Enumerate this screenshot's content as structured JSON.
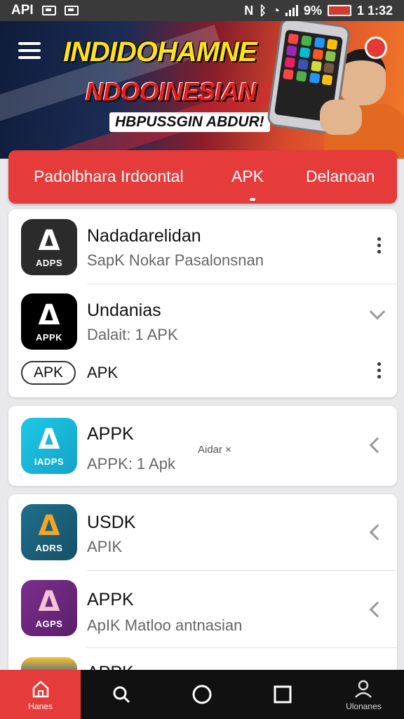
{
  "status_bar": {
    "left_text": "API",
    "battery_percent": "9%",
    "time": "1 1:32",
    "icons": [
      "notification-icon",
      "image-icon",
      "nfc-icon",
      "bluetooth-icon",
      "wifi-icon",
      "signal-icon",
      "battery-icon"
    ]
  },
  "banner": {
    "title": "INDIDOHAMNE",
    "subtitle": "NDOOINESIAN",
    "tagline": "HBPUSSGIN ABDUR!"
  },
  "tabs": [
    {
      "label": "Padolbhara Irdoontal"
    },
    {
      "label": "APK"
    },
    {
      "label": "Delanoan"
    }
  ],
  "apps": [
    {
      "title": "Nadadarelidan",
      "subtitle": "SapK Nokar Pasalonsnan",
      "icon_label": "ADPS",
      "icon_bg": "#2b2b2b"
    },
    {
      "title": "Undanias",
      "subtitle": "Dalait: 1 APK",
      "icon_label": "APPK",
      "icon_bg": "#000000",
      "pill_label": "APK",
      "extra_label": "APK"
    },
    {
      "title": "APPK",
      "subtitle": "APPK: 1 Apk",
      "icon_label": "IADPS",
      "icon_bg": "#1ea3d8",
      "overlay_text": "Aidar ×"
    },
    {
      "title": "USDK",
      "subtitle": "APIK",
      "icon_label": "ADRS",
      "icon_bg": "#1f6f8b"
    },
    {
      "title": "APPK",
      "subtitle": "ApIK Matloo antnasian",
      "icon_label": "AGPS",
      "icon_bg": "#6a2a7a"
    },
    {
      "title": "APPK",
      "subtitle": "",
      "icon_label": "",
      "icon_bg": "#244a9c"
    }
  ],
  "bottom_nav": [
    {
      "label": "Hanes",
      "icon": "home-icon"
    },
    {
      "label": "",
      "icon": "search-icon"
    },
    {
      "label": "",
      "icon": "circle-home-icon"
    },
    {
      "label": "",
      "icon": "square-recents-icon"
    },
    {
      "label": "Ulonanes",
      "icon": "profile-icon"
    }
  ],
  "colors": {
    "accent": "#e53b3b",
    "nav_bg": "#111111"
  }
}
